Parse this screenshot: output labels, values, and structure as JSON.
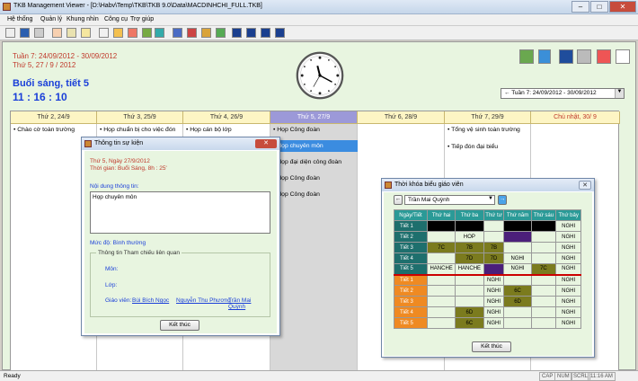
{
  "window": {
    "title": "TKB Management Viewer - [D:\\Habv\\Temp\\TKB\\TKB 9.0\\Data\\MACDINHCHI_FULL.TKB]",
    "min": "–",
    "max": "□",
    "close": "✕"
  },
  "menu": [
    "Hệ thống",
    "Quản lý",
    "Khung nhìn",
    "Công cụ",
    "Trợ giúp"
  ],
  "header": {
    "week": "Tuần 7: 24/09/2012 - 30/09/2012",
    "day": "Thứ 5, 27 / 9 / 2012",
    "session": "Buổi sáng, tiết 5",
    "time": "11 : 16 : 10",
    "week_select": "Tuần 7: 24/09/2012 - 30/09/2012",
    "prev": "←",
    "next": "→"
  },
  "days": [
    {
      "label": "Thứ 2, 24/9",
      "items": [
        "• Chào cờ toàn trường"
      ]
    },
    {
      "label": "Thứ 3, 25/9",
      "items": [
        "• Họp chuẩn bị cho việc đón"
      ]
    },
    {
      "label": "Thứ 4, 26/9",
      "items": [
        "• Họp cán bộ lớp"
      ]
    },
    {
      "label": "Thứ 5, 27/9",
      "items": [
        "• Họp Công đoàn",
        "• Họp chuyên môn",
        "• Họp đại diện công đoàn",
        "• Họp Công đoàn",
        "• Họp Công đoàn"
      ]
    },
    {
      "label": "Thứ 6, 28/9",
      "items": []
    },
    {
      "label": "Thứ 7, 29/9",
      "items": [
        "• Tổng vệ sinh toàn trường",
        "• Tiếp đón đại biểu"
      ]
    },
    {
      "label": "Chủ nhật, 30/ 9",
      "items": []
    }
  ],
  "event_dialog": {
    "title": "Thông tin sự kiện",
    "date": "Thứ 5, Ngày 27/9/2012",
    "time": "Thời gian: Buổi Sáng, 8h : 25'",
    "content_label": "Nội dung thông tin:",
    "content": "Họp chuyên môn",
    "level_label": "Mức độ: Bình thường",
    "ref_label": "Thông tin Tham chiếu liên quan",
    "subject_label": "Môn:",
    "class_label": "Lớp:",
    "teacher_label": "Giáo viên:",
    "teachers": [
      "Bùi Bích Ngọc",
      "Nguyễn Thu Phương",
      "Trần Mai Quỳnh"
    ],
    "ok": "Kết thúc"
  },
  "tkb_dialog": {
    "title": "Thời khóa biểu giáo viên",
    "teacher": "Trần Mai Quỳnh",
    "prev": "←",
    "next": "→",
    "columns": [
      "Ngày/Tiết",
      "Thứ hai",
      "Thứ ba",
      "Thứ tư",
      "Thứ năm",
      "Thứ sáu",
      "Thứ bảy"
    ],
    "morning": [
      {
        "label": "Tiết 1",
        "cells": [
          "",
          "",
          "",
          "",
          "",
          "NGHI"
        ]
      },
      {
        "label": "Tiết 2",
        "cells": [
          "",
          "HOP",
          "",
          "",
          "",
          "NGHI"
        ]
      },
      {
        "label": "Tiết 3",
        "cells": [
          "7C",
          "7B",
          "7B",
          "",
          "",
          "NGHI"
        ]
      },
      {
        "label": "Tiết 4",
        "cells": [
          "",
          "7D",
          "7D",
          "NGHI",
          "",
          "NGHI"
        ]
      },
      {
        "label": "Tiết 5",
        "cells": [
          "HANCHE",
          "HANCHE",
          "",
          "NGHI",
          "7C",
          "NGHI"
        ]
      }
    ],
    "afternoon": [
      {
        "label": "Tiết 1",
        "cells": [
          "",
          "",
          "NGHI",
          "",
          "",
          "NGHI"
        ]
      },
      {
        "label": "Tiết 2",
        "cells": [
          "",
          "",
          "NGHI",
          "6C",
          "",
          "NGHI"
        ]
      },
      {
        "label": "Tiết 3",
        "cells": [
          "",
          "",
          "NGHI",
          "6D",
          "",
          "NGHI"
        ]
      },
      {
        "label": "Tiết 4",
        "cells": [
          "",
          "6D",
          "NGHI",
          "",
          "",
          "NGHI"
        ]
      },
      {
        "label": "Tiết 5",
        "cells": [
          "",
          "6C",
          "NGHI",
          "",
          "",
          "NGHI"
        ]
      }
    ],
    "ok": "Kết thúc"
  },
  "status": {
    "left": "Ready",
    "cap": "CAP",
    "num": "NUM",
    "scrl": "SCRL",
    "clock": "11:16 AM"
  }
}
